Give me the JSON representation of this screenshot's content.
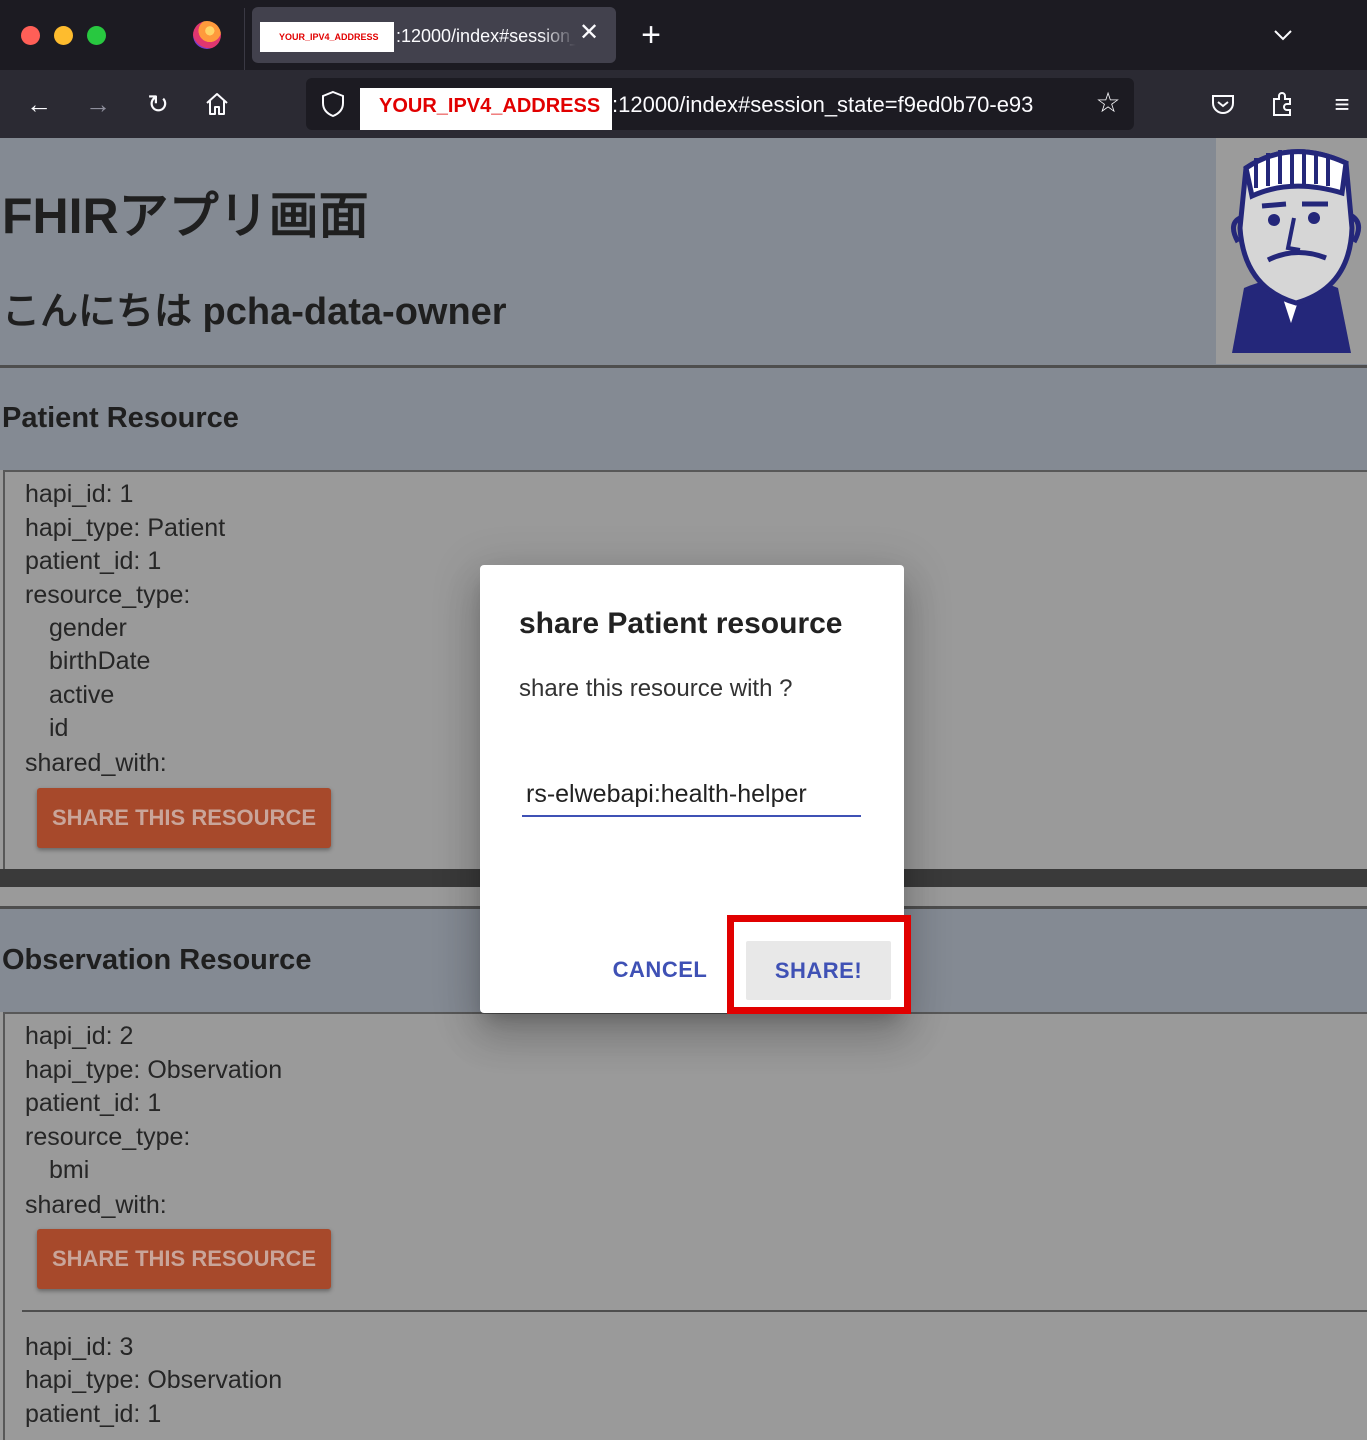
{
  "browser": {
    "tab": {
      "host_redacted": "YOUR_IPV4_ADDRESS",
      "title": ":12000/index#session_state=f9ed0b70-e93",
      "close_glyph": "✕"
    },
    "new_tab_glyph": "+",
    "tab_list_glyph": "⌄",
    "nav": {
      "back_glyph": "←",
      "forward_glyph": "→",
      "reload_glyph": "↻"
    },
    "url": {
      "host_redacted": "YOUR_IPV4_ADDRESS",
      "path": ":12000/index#session_state=f9ed0b70-e93",
      "bookmark_glyph": "☆"
    },
    "menu_glyph": "≡",
    "icons": [
      "firefox-logo",
      "back-icon",
      "forward-icon",
      "reload-icon",
      "home-icon",
      "shield-icon",
      "star-icon",
      "pocket-icon",
      "extensions-icon",
      "menu-icon"
    ]
  },
  "app": {
    "title": "FHIRアプリ画面",
    "greeting": "こんにちは pcha-data-owner"
  },
  "patient_section": {
    "title": "Patient Resource",
    "resources": [
      {
        "hapi_id": "hapi_id: 1",
        "hapi_type": "hapi_type: Patient",
        "patient_id": "patient_id: 1",
        "resource_type_label": "resource_type:",
        "resource_types": [
          "gender",
          "birthDate",
          "active",
          "id"
        ],
        "shared_with_label": "shared_with:",
        "share_button": "SHARE THIS RESOURCE"
      }
    ]
  },
  "observation_section": {
    "title": "Observation Resource",
    "resources": [
      {
        "hapi_id": "hapi_id: 2",
        "hapi_type": "hapi_type: Observation",
        "patient_id": "patient_id: 1",
        "resource_type_label": "resource_type:",
        "resource_types": [
          "bmi"
        ],
        "shared_with_label": "shared_with:",
        "share_button": "SHARE THIS RESOURCE"
      },
      {
        "hapi_id": "hapi_id: 3",
        "hapi_type": "hapi_type: Observation",
        "patient_id": "patient_id: 1"
      }
    ]
  },
  "dialog": {
    "title": "share Patient resource",
    "text": "share this resource with ?",
    "input_value": "rs-elwebapi:health-helper",
    "cancel_label": "CANCEL",
    "share_label": "SHARE!"
  },
  "colors": {
    "accent": "#3f51b5",
    "share_button": "#a7492b",
    "highlight": "#e10000",
    "redaction_text": "#e10000"
  }
}
